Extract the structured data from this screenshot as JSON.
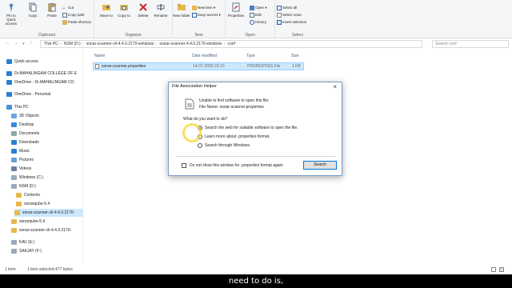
{
  "ribbon": {
    "clipboard": {
      "label": "Clipboard",
      "pin_label": "Pin to Quick access",
      "copy_label": "Copy",
      "paste_label": "Paste",
      "cut_label": "Cut",
      "copy_path_label": "Copy path",
      "paste_shortcut_label": "Paste shortcut"
    },
    "organize": {
      "label": "Organize",
      "move_label": "Move to",
      "copy_to_label": "Copy to",
      "delete_label": "Delete",
      "rename_label": "Rename"
    },
    "new": {
      "label": "New",
      "new_folder_label": "New folder",
      "new_item_label": "New item",
      "easy_access_label": "Easy access"
    },
    "open": {
      "label": "Open",
      "properties_label": "Properties",
      "open_label": "Open",
      "edit_label": "Edit",
      "history_label": "History"
    },
    "select": {
      "label": "Select",
      "select_all_label": "Select all",
      "select_none_label": "Select none",
      "invert_label": "Invert selection"
    }
  },
  "address": {
    "crumbs": [
      "This PC",
      "NSM (D:)",
      "sonar-scanner-cli-4.4.0.2170-windows",
      "sonar-scanner-4.4.0.2170-windows",
      "conf"
    ],
    "search_placeholder": "Search conf"
  },
  "nav": {
    "quick_access": "Quick access",
    "items": [
      "Dr.MAHALINGAM COLLEGE OF E",
      "OneDrive - Dr.MAHALINGAM CO",
      "OneDrive - Personal",
      "This PC",
      "3D Objects",
      "Desktop",
      "Documents",
      "Downloads",
      "Music",
      "Pictures",
      "Videos",
      "Windows (C:)",
      "NSM (D:)",
      "Contents",
      "sonarqube-5.4",
      "sonar-scanner-cli-4.4.0.2170-",
      "sonarqube-5.4",
      "sonar-scanner-cli-4.4.0.2170-",
      "KAV (E:)",
      "SAKJAY (F:)"
    ]
  },
  "columns": {
    "name": "Name",
    "date": "Date modified",
    "type": "Type",
    "size": "Size"
  },
  "file": {
    "name": "sonar-scanner.properties",
    "date": "14-07-2020 23:10",
    "type": "PROPERTIES File",
    "size": "1 KB"
  },
  "status": {
    "count": "1 item",
    "selected": "1 item selected  477 bytes"
  },
  "dialog": {
    "title": "File Association Helper",
    "message": "Unable to find software to open this file:",
    "file_name": "File Name:  sonar-scanner.properties",
    "question": "What do you want to do?",
    "options": [
      "Search the web for suitable software to open the file.",
      "Learn more about .properties format.",
      "Search through Windows."
    ],
    "checkbox_label": "Do not show this window for .properties format again.",
    "search_button": "Search"
  },
  "caption": "need to do is,",
  "colors": {
    "selection": "#cce8ff",
    "accent": "#0078d7",
    "folder": "#e8b84a"
  }
}
